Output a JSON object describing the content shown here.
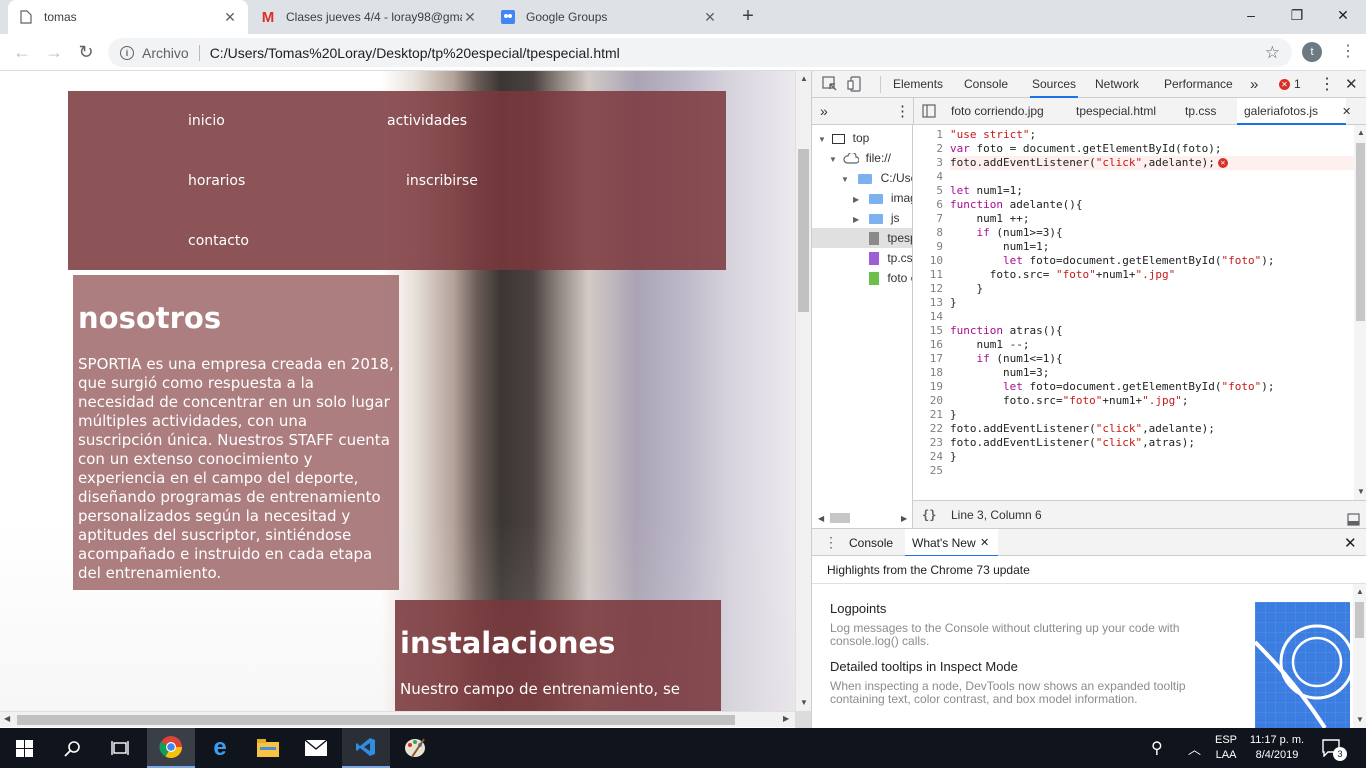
{
  "browser": {
    "tabs": [
      {
        "title": "tomas",
        "icon": "page-icon"
      },
      {
        "title": "Clases jueves 4/4 - loray98@gma",
        "icon": "gmail-icon"
      },
      {
        "title": "Google Groups",
        "icon": "google-groups-icon"
      }
    ],
    "new_tab": "+",
    "window": {
      "minimize": "–",
      "maximize": "❐",
      "close": "✕"
    },
    "toolbar": {
      "back": "←",
      "forward": "→",
      "reload": "↻"
    },
    "omnibox": {
      "scheme_label": "Archivo",
      "url": "C:/Users/Tomas%20Loray/Desktop/tp%20especial/tpespecial.html",
      "star": "☆"
    },
    "profile_initial": "t",
    "menu": "⋮"
  },
  "page": {
    "nav": {
      "links": [
        "inicio",
        "actividades",
        "horarios",
        "inscribirse",
        "contacto"
      ]
    },
    "nosotros": {
      "title": "nosotros",
      "text": "SPORTIA es una empresa creada en 2018, que surgió como respuesta a la necesidad de concentrar en un solo lugar múltiples actividades, con una suscripción única. Nuestros STAFF cuenta con un extenso conocimiento y experiencia en el campo del deporte, diseñando programas de entrenamiento personalizados según la necesitad y aptitudes del suscriptor, sintiéndose acompañado e instruido en cada etapa del entrenamiento."
    },
    "instalaciones": {
      "title": "instalaciones",
      "text": "Nuestro campo de entrenamiento, se"
    }
  },
  "devtools": {
    "tabs": [
      "Elements",
      "Console",
      "Sources",
      "Network",
      "Performance"
    ],
    "selected_tab": "Sources",
    "more": "»",
    "error_count": "1",
    "file_tabs": [
      "foto corriendo.jpg",
      "tpespecial.html",
      "tp.css",
      "galeriafotos.js"
    ],
    "tree": {
      "top": "top",
      "origin": "file://",
      "folder": "C:/User",
      "subfolders": [
        "imag",
        "js"
      ],
      "files": [
        "tpesp",
        "tp.css",
        "foto c"
      ]
    },
    "code_lines": [
      "\"use strict\";",
      "var foto = document.getElementById(foto);",
      "foto.addEventListener(\"click\",adelante);",
      "",
      "let num1=1;",
      "function adelante(){",
      "    num1 ++;",
      "    if (num1>=3){",
      "        num1=1;",
      "        let foto=document.getElementById(\"foto\");",
      "      foto.src= \"foto\"+num1+\".jpg\"",
      "    }",
      "}",
      "",
      "function atras(){",
      "    num1 --;",
      "    if (num1<=1){",
      "        num1=3;",
      "        let foto=document.getElementById(\"foto\");",
      "        foto.src=\"foto\"+num1+\".jpg\";",
      "}",
      "foto.addEventListener(\"click\",adelante);",
      "foto.addEventListener(\"click\",atras);",
      "}",
      ""
    ],
    "line_numbers": [
      "1",
      "2",
      "3",
      "4",
      "5",
      "6",
      "7",
      "8",
      "9",
      "10",
      "11",
      "12",
      "13",
      "14",
      "15",
      "16",
      "17",
      "18",
      "19",
      "20",
      "21",
      "22",
      "23",
      "24",
      "25"
    ],
    "error_line": 3,
    "status": "Line 3, Column 6",
    "format_button": "{}",
    "drawer_tabs": [
      "Console",
      "What's New"
    ],
    "whats_new": {
      "header": "Highlights from the Chrome 73 update",
      "items": [
        {
          "title": "Logpoints",
          "desc": "Log messages to the Console without cluttering up your code with console.log() calls."
        },
        {
          "title": "Detailed tooltips in Inspect Mode",
          "desc": "When inspecting a node, DevTools now shows an expanded tooltip containing text, color contrast, and box model information."
        }
      ]
    }
  },
  "taskbar": {
    "language": "ESP",
    "layout": "LAA",
    "time": "11:17 p. m.",
    "date": "8/4/2019",
    "notifications": "3"
  },
  "colors": {
    "nav_bg": "#7a383c",
    "box_light": "#a06c6e",
    "accent": "#1a73e8",
    "error": "#d93025"
  }
}
